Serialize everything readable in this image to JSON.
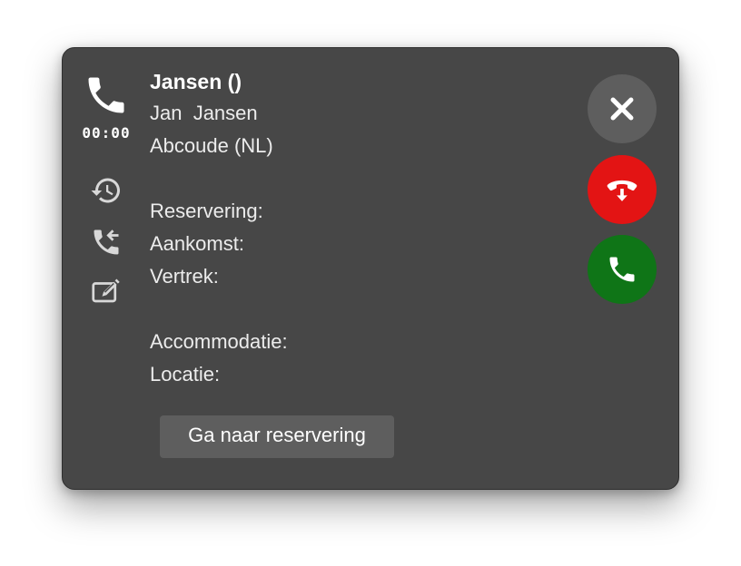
{
  "call": {
    "timer": "00:00",
    "caller_title": "Jansen ()",
    "caller_name": "Jan  Jansen",
    "caller_location": "Abcoude (NL)"
  },
  "details": {
    "reservation_label": "Reservering:",
    "arrival_label": "Aankomst:",
    "departure_label": "Vertrek:",
    "accommodation_label": "Accommodatie:",
    "location_label": "Locatie:"
  },
  "actions": {
    "goto_reservation_label": "Ga naar reservering"
  },
  "icons": {
    "main": "phone-icon",
    "history": "history-icon",
    "transfer": "call-transfer-icon",
    "notes": "edit-note-icon",
    "close": "close-icon",
    "hangup": "hang-up-icon",
    "answer": "answer-call-icon"
  },
  "colors": {
    "panel_bg": "#474747",
    "hangup": "#e31414",
    "answer": "#0f7517",
    "close": "#5e5e5e"
  }
}
